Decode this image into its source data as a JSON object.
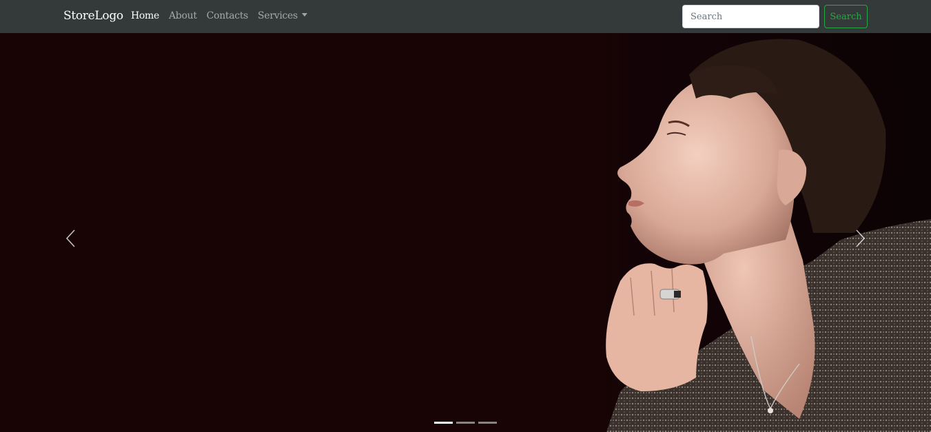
{
  "navbar": {
    "brand": "StoreLogo",
    "links": [
      {
        "label": "Home",
        "active": true
      },
      {
        "label": "About",
        "active": false
      },
      {
        "label": "Contacts",
        "active": false
      },
      {
        "label": "Services",
        "active": false,
        "dropdown": true
      }
    ],
    "search": {
      "placeholder": "Search",
      "value": "",
      "button_label": "Search"
    },
    "colors": {
      "background": "#343a3a",
      "search_button": "#28a745"
    }
  },
  "carousel": {
    "prev_icon": "chevron-left-icon",
    "next_icon": "chevron-right-icon",
    "indicators_count": 3,
    "active_index": 0,
    "slide_image": "woman-profile-with-ring-photo",
    "background": "#180405"
  }
}
